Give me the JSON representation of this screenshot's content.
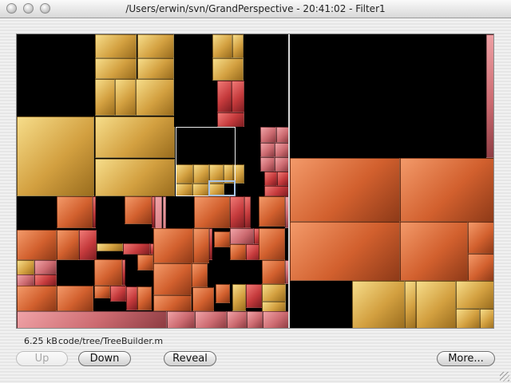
{
  "window": {
    "title": "/Users/erwin/svn/GrandPerspective - 20:41:02 - Filter1"
  },
  "status": {
    "size": "6.25 kB",
    "path": "code/tree/TreeBuilder.m"
  },
  "buttons": {
    "up": "Up",
    "down": "Down",
    "reveal": "Reveal",
    "more": "More..."
  },
  "colors": {
    "gold": "#e8b440",
    "red": "#d8504c",
    "orange": "#e0703c",
    "pink": "#d66f75",
    "selection": "#a9c4e6"
  }
}
